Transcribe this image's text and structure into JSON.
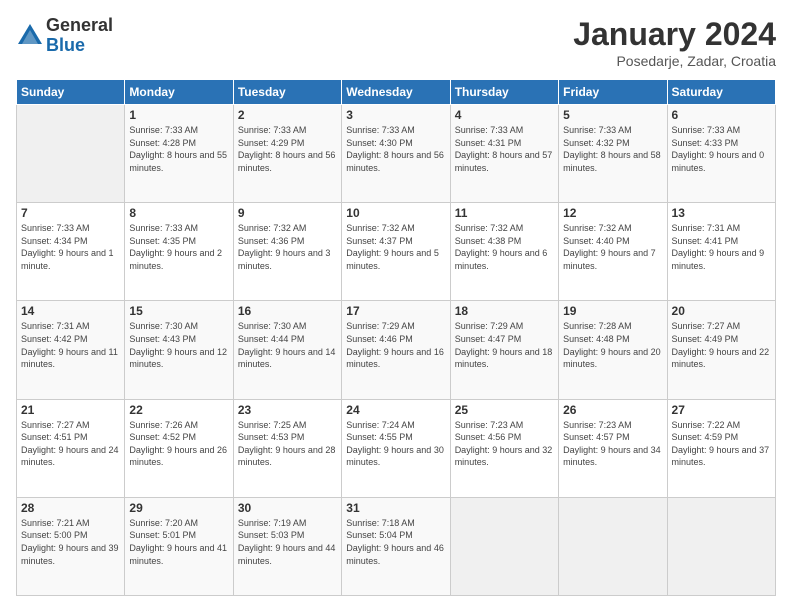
{
  "logo": {
    "general": "General",
    "blue": "Blue"
  },
  "title": "January 2024",
  "location": "Posedarje, Zadar, Croatia",
  "days_of_week": [
    "Sunday",
    "Monday",
    "Tuesday",
    "Wednesday",
    "Thursday",
    "Friday",
    "Saturday"
  ],
  "weeks": [
    [
      {
        "day": "",
        "sunrise": "",
        "sunset": "",
        "daylight": ""
      },
      {
        "day": "1",
        "sunrise": "Sunrise: 7:33 AM",
        "sunset": "Sunset: 4:28 PM",
        "daylight": "Daylight: 8 hours and 55 minutes."
      },
      {
        "day": "2",
        "sunrise": "Sunrise: 7:33 AM",
        "sunset": "Sunset: 4:29 PM",
        "daylight": "Daylight: 8 hours and 56 minutes."
      },
      {
        "day": "3",
        "sunrise": "Sunrise: 7:33 AM",
        "sunset": "Sunset: 4:30 PM",
        "daylight": "Daylight: 8 hours and 56 minutes."
      },
      {
        "day": "4",
        "sunrise": "Sunrise: 7:33 AM",
        "sunset": "Sunset: 4:31 PM",
        "daylight": "Daylight: 8 hours and 57 minutes."
      },
      {
        "day": "5",
        "sunrise": "Sunrise: 7:33 AM",
        "sunset": "Sunset: 4:32 PM",
        "daylight": "Daylight: 8 hours and 58 minutes."
      },
      {
        "day": "6",
        "sunrise": "Sunrise: 7:33 AM",
        "sunset": "Sunset: 4:33 PM",
        "daylight": "Daylight: 9 hours and 0 minutes."
      }
    ],
    [
      {
        "day": "7",
        "sunrise": "Sunrise: 7:33 AM",
        "sunset": "Sunset: 4:34 PM",
        "daylight": "Daylight: 9 hours and 1 minute."
      },
      {
        "day": "8",
        "sunrise": "Sunrise: 7:33 AM",
        "sunset": "Sunset: 4:35 PM",
        "daylight": "Daylight: 9 hours and 2 minutes."
      },
      {
        "day": "9",
        "sunrise": "Sunrise: 7:32 AM",
        "sunset": "Sunset: 4:36 PM",
        "daylight": "Daylight: 9 hours and 3 minutes."
      },
      {
        "day": "10",
        "sunrise": "Sunrise: 7:32 AM",
        "sunset": "Sunset: 4:37 PM",
        "daylight": "Daylight: 9 hours and 5 minutes."
      },
      {
        "day": "11",
        "sunrise": "Sunrise: 7:32 AM",
        "sunset": "Sunset: 4:38 PM",
        "daylight": "Daylight: 9 hours and 6 minutes."
      },
      {
        "day": "12",
        "sunrise": "Sunrise: 7:32 AM",
        "sunset": "Sunset: 4:40 PM",
        "daylight": "Daylight: 9 hours and 7 minutes."
      },
      {
        "day": "13",
        "sunrise": "Sunrise: 7:31 AM",
        "sunset": "Sunset: 4:41 PM",
        "daylight": "Daylight: 9 hours and 9 minutes."
      }
    ],
    [
      {
        "day": "14",
        "sunrise": "Sunrise: 7:31 AM",
        "sunset": "Sunset: 4:42 PM",
        "daylight": "Daylight: 9 hours and 11 minutes."
      },
      {
        "day": "15",
        "sunrise": "Sunrise: 7:30 AM",
        "sunset": "Sunset: 4:43 PM",
        "daylight": "Daylight: 9 hours and 12 minutes."
      },
      {
        "day": "16",
        "sunrise": "Sunrise: 7:30 AM",
        "sunset": "Sunset: 4:44 PM",
        "daylight": "Daylight: 9 hours and 14 minutes."
      },
      {
        "day": "17",
        "sunrise": "Sunrise: 7:29 AM",
        "sunset": "Sunset: 4:46 PM",
        "daylight": "Daylight: 9 hours and 16 minutes."
      },
      {
        "day": "18",
        "sunrise": "Sunrise: 7:29 AM",
        "sunset": "Sunset: 4:47 PM",
        "daylight": "Daylight: 9 hours and 18 minutes."
      },
      {
        "day": "19",
        "sunrise": "Sunrise: 7:28 AM",
        "sunset": "Sunset: 4:48 PM",
        "daylight": "Daylight: 9 hours and 20 minutes."
      },
      {
        "day": "20",
        "sunrise": "Sunrise: 7:27 AM",
        "sunset": "Sunset: 4:49 PM",
        "daylight": "Daylight: 9 hours and 22 minutes."
      }
    ],
    [
      {
        "day": "21",
        "sunrise": "Sunrise: 7:27 AM",
        "sunset": "Sunset: 4:51 PM",
        "daylight": "Daylight: 9 hours and 24 minutes."
      },
      {
        "day": "22",
        "sunrise": "Sunrise: 7:26 AM",
        "sunset": "Sunset: 4:52 PM",
        "daylight": "Daylight: 9 hours and 26 minutes."
      },
      {
        "day": "23",
        "sunrise": "Sunrise: 7:25 AM",
        "sunset": "Sunset: 4:53 PM",
        "daylight": "Daylight: 9 hours and 28 minutes."
      },
      {
        "day": "24",
        "sunrise": "Sunrise: 7:24 AM",
        "sunset": "Sunset: 4:55 PM",
        "daylight": "Daylight: 9 hours and 30 minutes."
      },
      {
        "day": "25",
        "sunrise": "Sunrise: 7:23 AM",
        "sunset": "Sunset: 4:56 PM",
        "daylight": "Daylight: 9 hours and 32 minutes."
      },
      {
        "day": "26",
        "sunrise": "Sunrise: 7:23 AM",
        "sunset": "Sunset: 4:57 PM",
        "daylight": "Daylight: 9 hours and 34 minutes."
      },
      {
        "day": "27",
        "sunrise": "Sunrise: 7:22 AM",
        "sunset": "Sunset: 4:59 PM",
        "daylight": "Daylight: 9 hours and 37 minutes."
      }
    ],
    [
      {
        "day": "28",
        "sunrise": "Sunrise: 7:21 AM",
        "sunset": "Sunset: 5:00 PM",
        "daylight": "Daylight: 9 hours and 39 minutes."
      },
      {
        "day": "29",
        "sunrise": "Sunrise: 7:20 AM",
        "sunset": "Sunset: 5:01 PM",
        "daylight": "Daylight: 9 hours and 41 minutes."
      },
      {
        "day": "30",
        "sunrise": "Sunrise: 7:19 AM",
        "sunset": "Sunset: 5:03 PM",
        "daylight": "Daylight: 9 hours and 44 minutes."
      },
      {
        "day": "31",
        "sunrise": "Sunrise: 7:18 AM",
        "sunset": "Sunset: 5:04 PM",
        "daylight": "Daylight: 9 hours and 46 minutes."
      },
      {
        "day": "",
        "sunrise": "",
        "sunset": "",
        "daylight": ""
      },
      {
        "day": "",
        "sunrise": "",
        "sunset": "",
        "daylight": ""
      },
      {
        "day": "",
        "sunrise": "",
        "sunset": "",
        "daylight": ""
      }
    ]
  ]
}
